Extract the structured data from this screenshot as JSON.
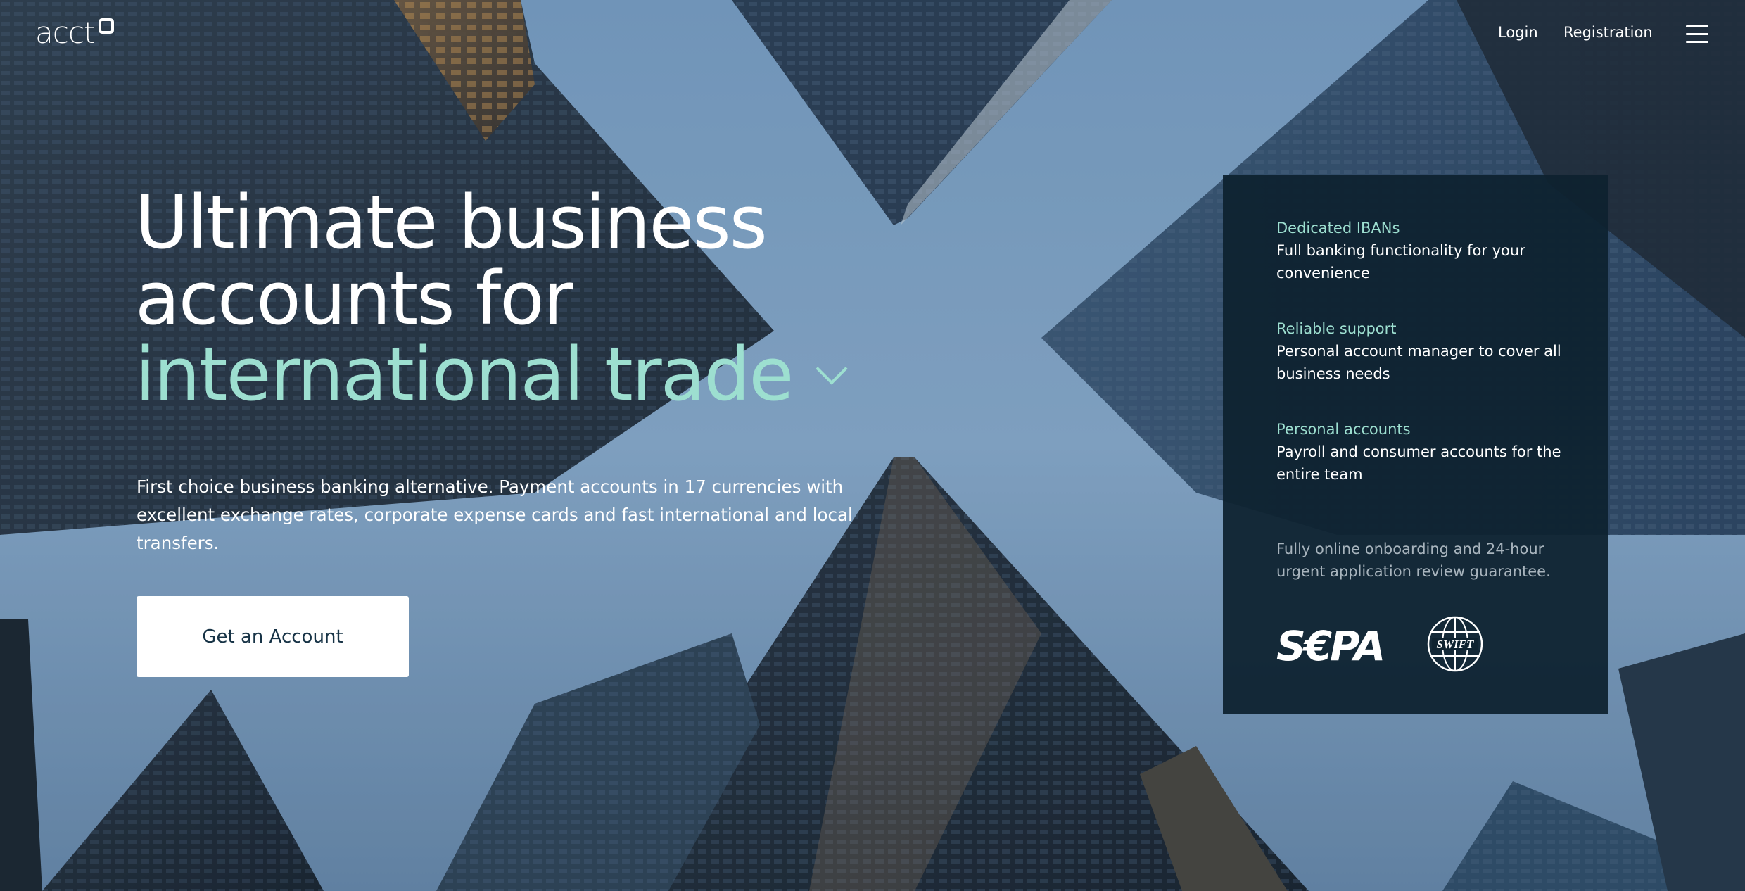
{
  "header": {
    "logo_text": "acct",
    "nav": {
      "login": "Login",
      "registration": "Registration"
    },
    "menu_icon": "hamburger-menu-icon"
  },
  "hero": {
    "title_line1": "Ultimate business",
    "title_line2": "accounts for",
    "title_line3": "international trade",
    "chevron_icon": "chevron-down-icon",
    "subtitle": "First choice business banking alternative. Payment accounts in 17 currencies with excellent exchange rates, corporate expense cards and fast international and local transfers.",
    "cta_label": "Get an Account"
  },
  "panel": {
    "features": [
      {
        "title": "Dedicated IBANs",
        "description": "Full banking functionality for your convenience"
      },
      {
        "title": "Reliable support",
        "description": "Personal account manager to cover all business needs"
      },
      {
        "title": "Personal accounts",
        "description": "Payroll and consumer accounts for the entire team"
      }
    ],
    "note": "Fully online onboarding and 24-hour urgent application review guarantee.",
    "logos": {
      "sepa": "S€PA",
      "swift": "SWIFT"
    }
  },
  "colors": {
    "accent": "#9ddfd0",
    "panel_bg": "#0e2230",
    "cta_text": "#173346"
  }
}
